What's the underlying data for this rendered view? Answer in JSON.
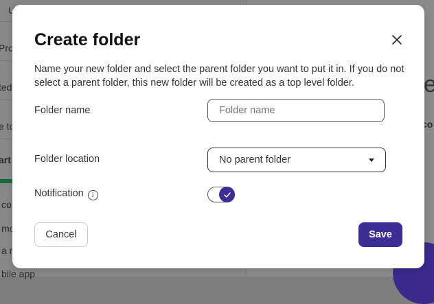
{
  "background": {
    "rows": [
      "U",
      "Pro",
      "ted",
      "e to",
      "art",
      "co",
      "mo",
      "a r",
      "bile app"
    ],
    "right_fragments": [
      "ne",
      "co"
    ]
  },
  "dialog": {
    "title": "Create folder",
    "description": "Name your new folder and select the parent folder you want to put it in. If you do not select a parent folder, this new folder will be created as a top level folder.",
    "folder_name_label": "Folder name",
    "folder_name_value": "",
    "folder_name_placeholder": "Folder name",
    "folder_location_label": "Folder location",
    "folder_location_value": "No parent folder",
    "notification_label": "Notification",
    "notification_enabled": true,
    "cancel_label": "Cancel",
    "save_label": "Save",
    "accent_color": "#3d2e96"
  }
}
